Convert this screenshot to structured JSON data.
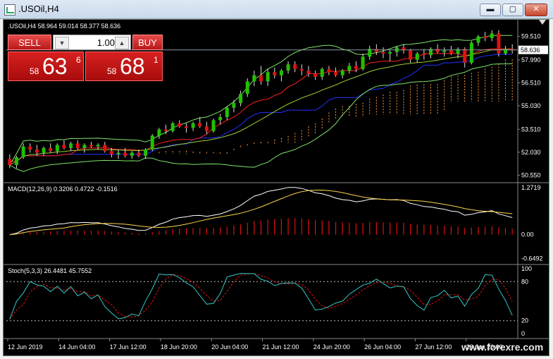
{
  "window": {
    "title": ".USOil,H4",
    "min_label": "▬",
    "max_label": "▢",
    "close_label": "✕"
  },
  "chart_header": ".USOil,H4  58.964 59.014 58.377 58.636",
  "trade_panel": {
    "sell_label": "SELL",
    "buy_label": "BUY",
    "lot_value": "1.00",
    "sell_prefix": "58",
    "sell_big": "63",
    "sell_sup": "6",
    "buy_prefix": "58",
    "buy_big": "68",
    "buy_sup": "1"
  },
  "price_axis": {
    "labels": [
      "59.510",
      "57.990",
      "56.510",
      "55.030",
      "53.510",
      "52.030",
      "50.550"
    ],
    "current": "58.636"
  },
  "macd": {
    "label": "MACD(12,26,9) 0.3206 0.4722 -0.1516",
    "axis_labels": [
      "1.2719",
      "0.00",
      "-0.6492"
    ]
  },
  "stoch": {
    "label": "Stoch(5,3,3) 26.4481 45.7552",
    "axis_labels": [
      "100",
      "80",
      "20",
      "0"
    ]
  },
  "time_axis": [
    "12 Jun 2019",
    "14 Jun 04:00",
    "17 Jun 12:00",
    "18 Jun 20:00",
    "20 Jun 04:00",
    "21 Jun 12:00",
    "24 Jun 20:00",
    "26 Jun 04:00",
    "27 Jun 12:00",
    "28 Jun 20:00"
  ],
  "watermark": "www.forexre.com",
  "colors": {
    "bull": "#22c000",
    "bear": "#e01010",
    "cloud_up": "#ff9a3c",
    "cloud_down": "#2a4cff",
    "bb": "#7fe36a",
    "ma_red": "#ff2020",
    "ma_blue": "#2030ff"
  },
  "chart_data": {
    "type": "candlestick",
    "candles": [
      [
        51.6,
        51.9,
        51.0,
        51.2
      ],
      [
        51.2,
        51.8,
        51.0,
        51.7
      ],
      [
        51.7,
        52.6,
        51.6,
        52.4
      ],
      [
        52.4,
        52.6,
        52.0,
        52.2
      ],
      [
        52.2,
        52.5,
        51.8,
        52.0
      ],
      [
        52.0,
        52.4,
        51.8,
        52.3
      ],
      [
        52.3,
        52.6,
        52.0,
        52.1
      ],
      [
        52.1,
        52.6,
        51.9,
        52.5
      ],
      [
        52.5,
        52.8,
        52.2,
        52.3
      ],
      [
        52.3,
        52.7,
        52.1,
        52.6
      ],
      [
        52.6,
        52.8,
        52.2,
        52.3
      ],
      [
        52.3,
        52.6,
        52.0,
        52.5
      ],
      [
        52.5,
        52.7,
        52.3,
        52.4
      ],
      [
        52.4,
        52.6,
        52.2,
        52.5
      ],
      [
        52.5,
        52.7,
        52.0,
        52.1
      ],
      [
        52.1,
        52.3,
        51.7,
        51.9
      ],
      [
        51.9,
        52.2,
        51.6,
        52.0
      ],
      [
        52.0,
        52.3,
        51.7,
        51.8
      ],
      [
        51.8,
        52.1,
        51.6,
        52.0
      ],
      [
        52.0,
        52.2,
        51.7,
        51.8
      ],
      [
        51.8,
        52.3,
        51.6,
        52.2
      ],
      [
        52.2,
        53.2,
        52.1,
        53.1
      ],
      [
        53.1,
        53.6,
        52.9,
        53.5
      ],
      [
        53.5,
        53.8,
        53.2,
        53.4
      ],
      [
        53.4,
        54.0,
        53.3,
        53.9
      ],
      [
        53.9,
        54.1,
        53.6,
        53.7
      ],
      [
        53.7,
        53.9,
        53.3,
        53.6
      ],
      [
        53.6,
        54.0,
        53.4,
        53.9
      ],
      [
        53.9,
        54.3,
        53.6,
        53.7
      ],
      [
        53.7,
        54.0,
        53.2,
        53.4
      ],
      [
        53.4,
        54.2,
        53.3,
        54.1
      ],
      [
        54.1,
        54.5,
        53.8,
        54.3
      ],
      [
        54.3,
        55.0,
        54.1,
        54.9
      ],
      [
        54.9,
        55.4,
        54.6,
        55.2
      ],
      [
        55.2,
        56.0,
        55.0,
        55.8
      ],
      [
        55.8,
        56.8,
        55.6,
        56.6
      ],
      [
        56.6,
        57.3,
        56.3,
        57.0
      ],
      [
        57.0,
        57.6,
        56.4,
        56.6
      ],
      [
        56.6,
        57.4,
        56.3,
        57.2
      ],
      [
        57.2,
        57.5,
        56.8,
        57.0
      ],
      [
        57.0,
        57.4,
        56.6,
        57.3
      ],
      [
        57.3,
        57.9,
        57.1,
        57.7
      ],
      [
        57.7,
        57.9,
        57.2,
        57.4
      ],
      [
        57.4,
        57.7,
        57.0,
        57.3
      ],
      [
        57.3,
        57.6,
        56.9,
        57.1
      ],
      [
        57.1,
        57.3,
        56.7,
        56.9
      ],
      [
        56.9,
        57.5,
        56.7,
        57.4
      ],
      [
        57.4,
        57.6,
        57.0,
        57.2
      ],
      [
        57.2,
        57.5,
        56.9,
        57.0
      ],
      [
        57.0,
        57.4,
        56.8,
        57.3
      ],
      [
        57.3,
        57.8,
        57.1,
        57.6
      ],
      [
        57.6,
        57.9,
        57.2,
        57.4
      ],
      [
        57.4,
        58.4,
        57.3,
        58.2
      ],
      [
        58.2,
        58.9,
        58.0,
        58.7
      ],
      [
        58.7,
        59.0,
        58.3,
        58.5
      ],
      [
        58.5,
        58.8,
        58.1,
        58.4
      ],
      [
        58.4,
        58.6,
        57.9,
        58.5
      ],
      [
        58.5,
        58.9,
        58.2,
        58.8
      ],
      [
        58.8,
        59.0,
        58.4,
        58.6
      ],
      [
        58.6,
        58.7,
        57.8,
        58.0
      ],
      [
        58.0,
        58.5,
        57.8,
        58.4
      ],
      [
        58.4,
        58.7,
        58.0,
        58.3
      ],
      [
        58.3,
        58.8,
        58.1,
        58.7
      ],
      [
        58.7,
        59.0,
        58.4,
        58.5
      ],
      [
        58.5,
        58.8,
        58.2,
        58.6
      ],
      [
        58.6,
        58.9,
        58.3,
        58.4
      ],
      [
        58.4,
        58.8,
        58.1,
        58.7
      ],
      [
        58.7,
        58.8,
        57.5,
        57.8
      ],
      [
        57.8,
        59.2,
        57.7,
        59.1
      ],
      [
        59.1,
        59.6,
        58.9,
        59.5
      ],
      [
        59.5,
        59.8,
        59.2,
        59.4
      ],
      [
        59.4,
        59.9,
        59.2,
        59.7
      ],
      [
        59.7,
        59.9,
        58.2,
        58.4
      ],
      [
        58.4,
        58.9,
        58.3,
        58.7
      ],
      [
        58.7,
        59.0,
        58.4,
        58.6
      ]
    ],
    "price_range": [
      50.2,
      60.4
    ],
    "macd_range": [
      -0.75,
      1.35
    ],
    "stoch_range": [
      -3,
      103
    ]
  }
}
